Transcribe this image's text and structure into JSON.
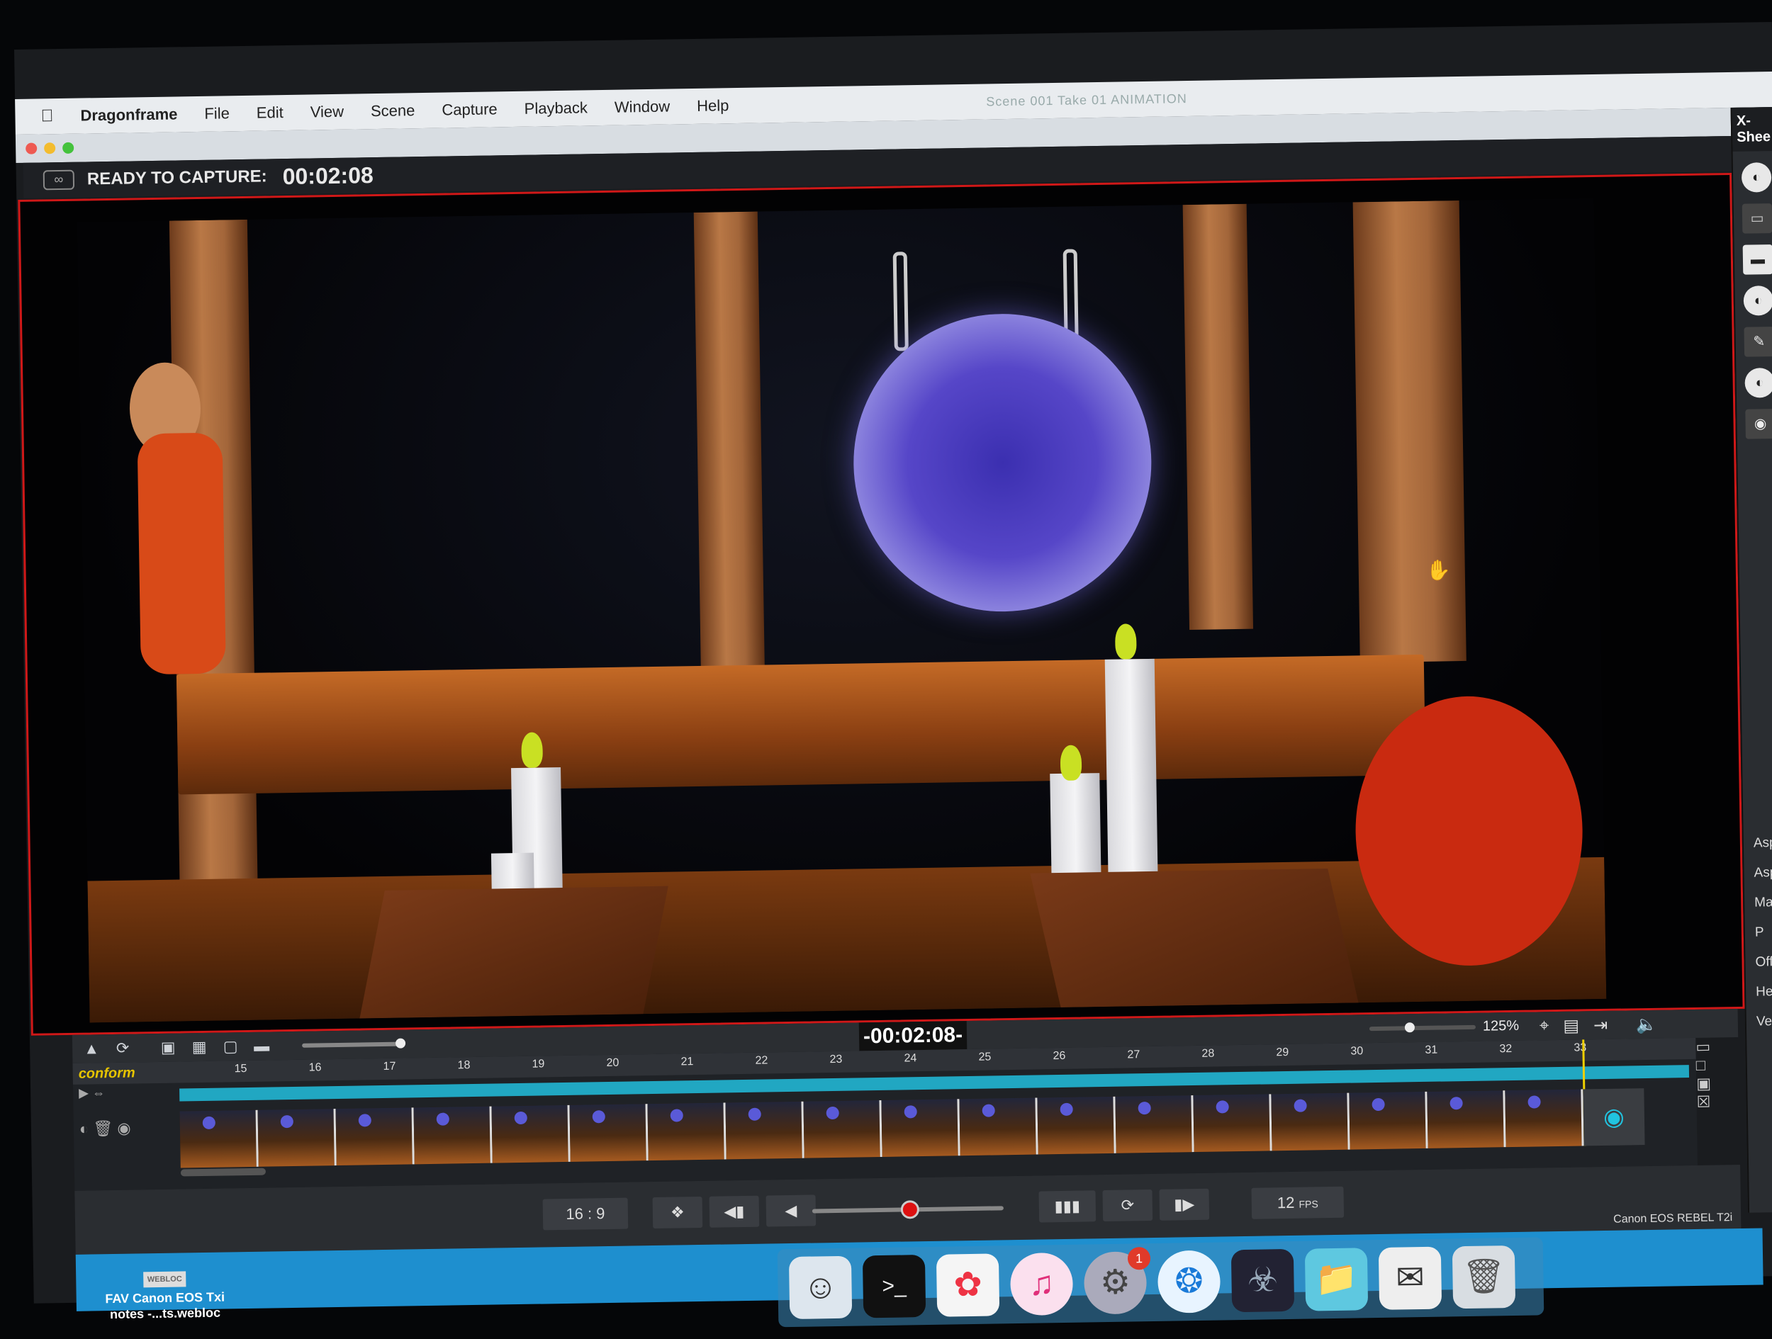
{
  "menubar": {
    "app": "Dragonframe",
    "items": [
      "File",
      "Edit",
      "View",
      "Scene",
      "Capture",
      "Playback",
      "Window",
      "Help"
    ],
    "window_title": "Scene 001 Take 01 ANIMATION"
  },
  "status": {
    "label": "READY TO CAPTURE:",
    "time": "00:02:08"
  },
  "xsheet": {
    "title": "X-Shee",
    "labels": [
      "Asp",
      "Aspe",
      "Mask",
      "P",
      "Offse",
      "He",
      "Ve"
    ]
  },
  "toolbar": {
    "timecode": "-00:02:08-",
    "zoom": "125%"
  },
  "timeline": {
    "conform_label": "conform",
    "frame_numbers": [
      "15",
      "16",
      "17",
      "18",
      "19",
      "20",
      "21",
      "22",
      "23",
      "24",
      "25",
      "26",
      "27",
      "28",
      "29",
      "30",
      "31",
      "32",
      "33"
    ]
  },
  "transport": {
    "aspect": "16 : 9",
    "fps": "12",
    "fps_unit": "FPS",
    "camera": "Canon EOS REBEL T2i"
  },
  "desktop": {
    "file_tag": "WEBLOC",
    "file_name": "FAV Canon EOS Txi notes -...ts.webloc"
  },
  "dock": {
    "badge_count": "1"
  },
  "colors": {
    "viewer_border": "#d01818",
    "conform": "#e6c400",
    "track": "#21a7c2",
    "playhead": "#f0d000"
  }
}
